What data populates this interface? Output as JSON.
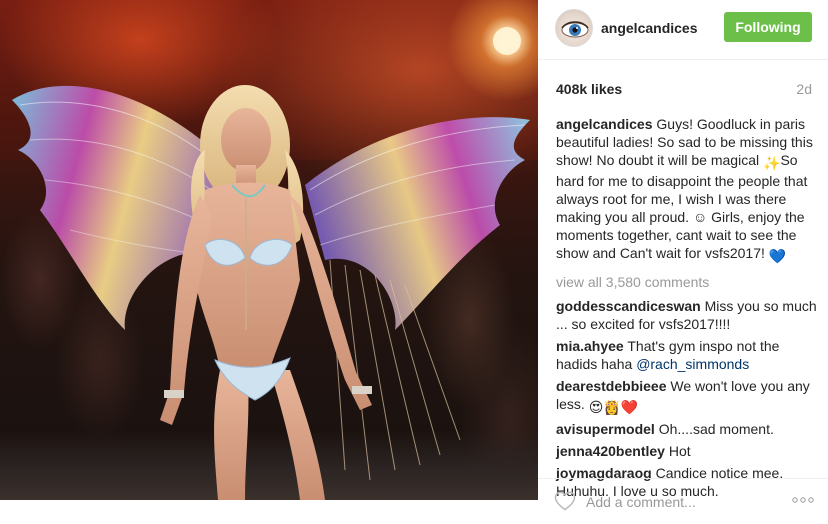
{
  "post": {
    "photo_alt": "",
    "likes": "408k likes",
    "age": "2d"
  },
  "header": {
    "username": "angelcandices",
    "follow_label": "Following",
    "follow_color": "#6cc04a"
  },
  "caption": {
    "username": "angelcandices",
    "text_1": " Guys! Goodluck in paris beautiful ladies! So sad to be missing this show! No doubt it will be magical ",
    "emoji_1": "✨",
    "text_2": "So hard for me to disappoint the people that always root for me, I wish I was there making you all proud. ",
    "emoji_2": "☺",
    "text_3": " Girls, enjoy the moments together, cant wait to see the show and Can't wait for vsfs2017! ",
    "emoji_3": "💙"
  },
  "view_all": "view all 3,580 comments",
  "comments": [
    {
      "user": "goddesscandiceswan",
      "text": " Miss you so much ... so excited for vsfs2017!!!!"
    },
    {
      "user": "mia.ahyee",
      "text": " That's gym inspo not the hadids haha ",
      "mention": "@rach_simmonds"
    },
    {
      "user": "dearestdebbieee",
      "text": " We won't love you any less. ",
      "emoji": "😍👸❤️"
    },
    {
      "user": "avisupermodel",
      "text": " Oh....sad moment."
    },
    {
      "user": "jenna420bentley",
      "text": " Hot"
    },
    {
      "user": "joymagdaraog",
      "text": " Candice notice mee. Huhuhu. I love u so much."
    }
  ],
  "footer": {
    "placeholder": "Add a comment...",
    "heart_icon": "heart-outline-icon",
    "more_icon": "more-options-icon"
  }
}
